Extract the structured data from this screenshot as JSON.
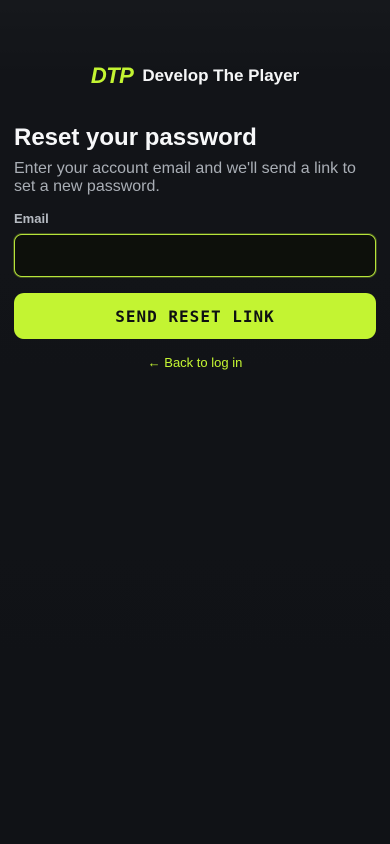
{
  "brand": {
    "logo": "DTP",
    "name": "Develop The Player"
  },
  "page": {
    "title": "Reset your password",
    "subtitle": "Enter your account email and we'll send a link to set a new password."
  },
  "form": {
    "email_label": "Email",
    "email_value": "",
    "submit_label": "SEND RESET LINK"
  },
  "links": {
    "back_to_login": "← Back to log in"
  },
  "colors": {
    "accent": "#c3f432",
    "background": "#121418"
  }
}
